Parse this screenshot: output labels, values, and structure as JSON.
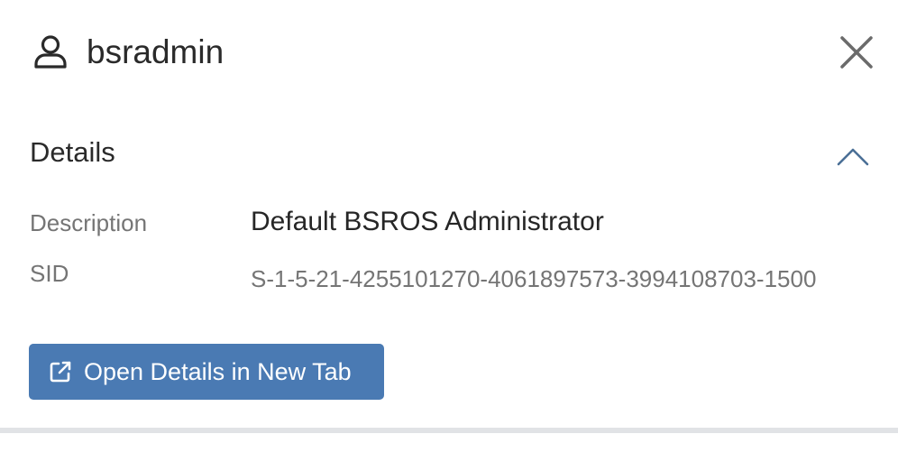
{
  "header": {
    "user_name": "bsradmin",
    "user_icon": "user-icon",
    "close_icon": "close-icon"
  },
  "details": {
    "title": "Details",
    "toggle_icon": "chevron-up-icon",
    "rows": [
      {
        "label": "Description",
        "value": "Default BSROS Administrator"
      },
      {
        "label": "SID",
        "value": "S-1-5-21-4255101270-4061897573-3994108703-1500"
      }
    ]
  },
  "actions": {
    "open_details_label": "Open Details in New Tab",
    "open_details_icon": "external-link-icon"
  },
  "colors": {
    "button_background": "#4a7ab3",
    "chevron": "#4a6f96",
    "label_text": "#757575",
    "divider": "#e1e3e6"
  }
}
